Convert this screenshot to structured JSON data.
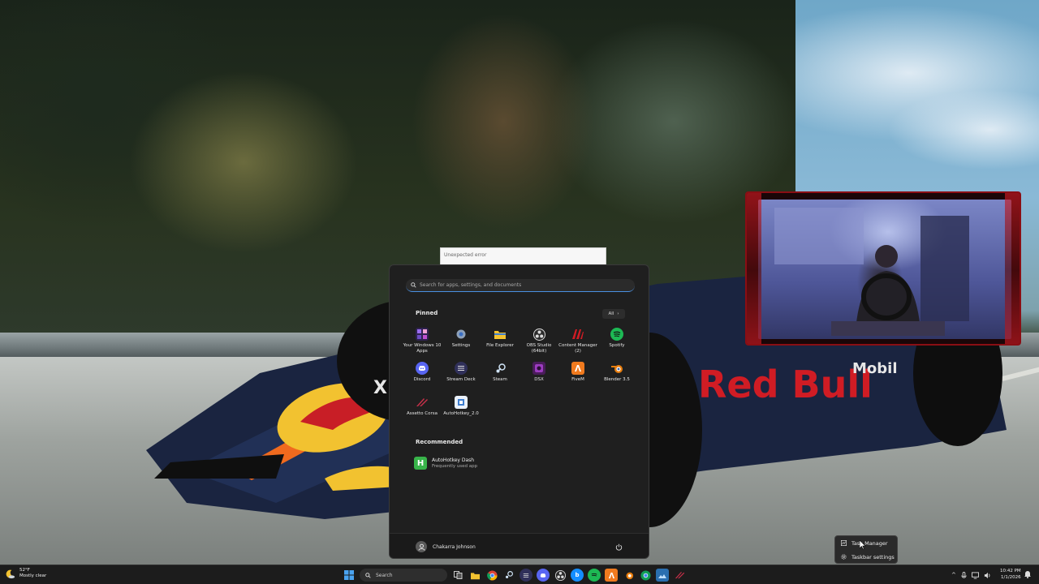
{
  "error_tooltip": {
    "text": "Unexpected error"
  },
  "start_menu": {
    "search_placeholder": "Search for apps, settings, and documents",
    "pinned_title": "Pinned",
    "all_button": "All",
    "pinned_apps": [
      {
        "label": "Your Windows 10 Apps",
        "icon": "apps-folder-icon",
        "color": "#6b4cc4"
      },
      {
        "label": "Settings",
        "icon": "gear-icon",
        "color": "#3a6fc4"
      },
      {
        "label": "File Explorer",
        "icon": "folder-icon",
        "color": "#f2c230"
      },
      {
        "label": "OBS Studio (64bit)",
        "icon": "obs-icon",
        "color": "#2b2b2b"
      },
      {
        "label": "Content Manager (2)",
        "icon": "content-manager-icon",
        "color": "#d01c24"
      },
      {
        "label": "Spotify",
        "icon": "spotify-icon",
        "color": "#1db954"
      },
      {
        "label": "Discord",
        "icon": "discord-icon",
        "color": "#5865f2"
      },
      {
        "label": "Stream Deck",
        "icon": "stream-deck-icon",
        "color": "#30305a"
      },
      {
        "label": "Steam",
        "icon": "steam-icon",
        "color": "#1b2838"
      },
      {
        "label": "DSX",
        "icon": "dsx-icon",
        "color": "#7a2a8a"
      },
      {
        "label": "FiveM",
        "icon": "fivem-icon",
        "color": "#f07a1e"
      },
      {
        "label": "Blender 3.5",
        "icon": "blender-icon",
        "color": "#e87d0d"
      },
      {
        "label": "Assetto Corsa",
        "icon": "assetto-corsa-icon",
        "color": "#c8304a"
      },
      {
        "label": "AutoHotkey_2.0",
        "icon": "autohotkey-icon",
        "color": "#3f7fd0"
      }
    ],
    "recommended_title": "Recommended",
    "recommended": [
      {
        "name": "AutoHotkey Dash",
        "subtitle": "Frequently used app",
        "icon": "autohotkey-dash-icon",
        "glyph": "H"
      }
    ],
    "user_name": "Chakarra Johnson"
  },
  "context_menu": {
    "items": [
      {
        "label": "Task Manager",
        "icon": "task-manager-icon"
      },
      {
        "label": "Taskbar settings",
        "icon": "gear-icon"
      }
    ]
  },
  "taskbar": {
    "weather_temp": "52°F",
    "weather_desc": "Mostly clear",
    "search_label": "Search",
    "time": "10:42 PM",
    "date": "1/1/2026"
  },
  "colors": {
    "start_bg": "#1f1f1f",
    "taskbar_bg": "#1c1c1c",
    "accent": "#4a8fe0",
    "redbull_red": "#d01c24"
  }
}
